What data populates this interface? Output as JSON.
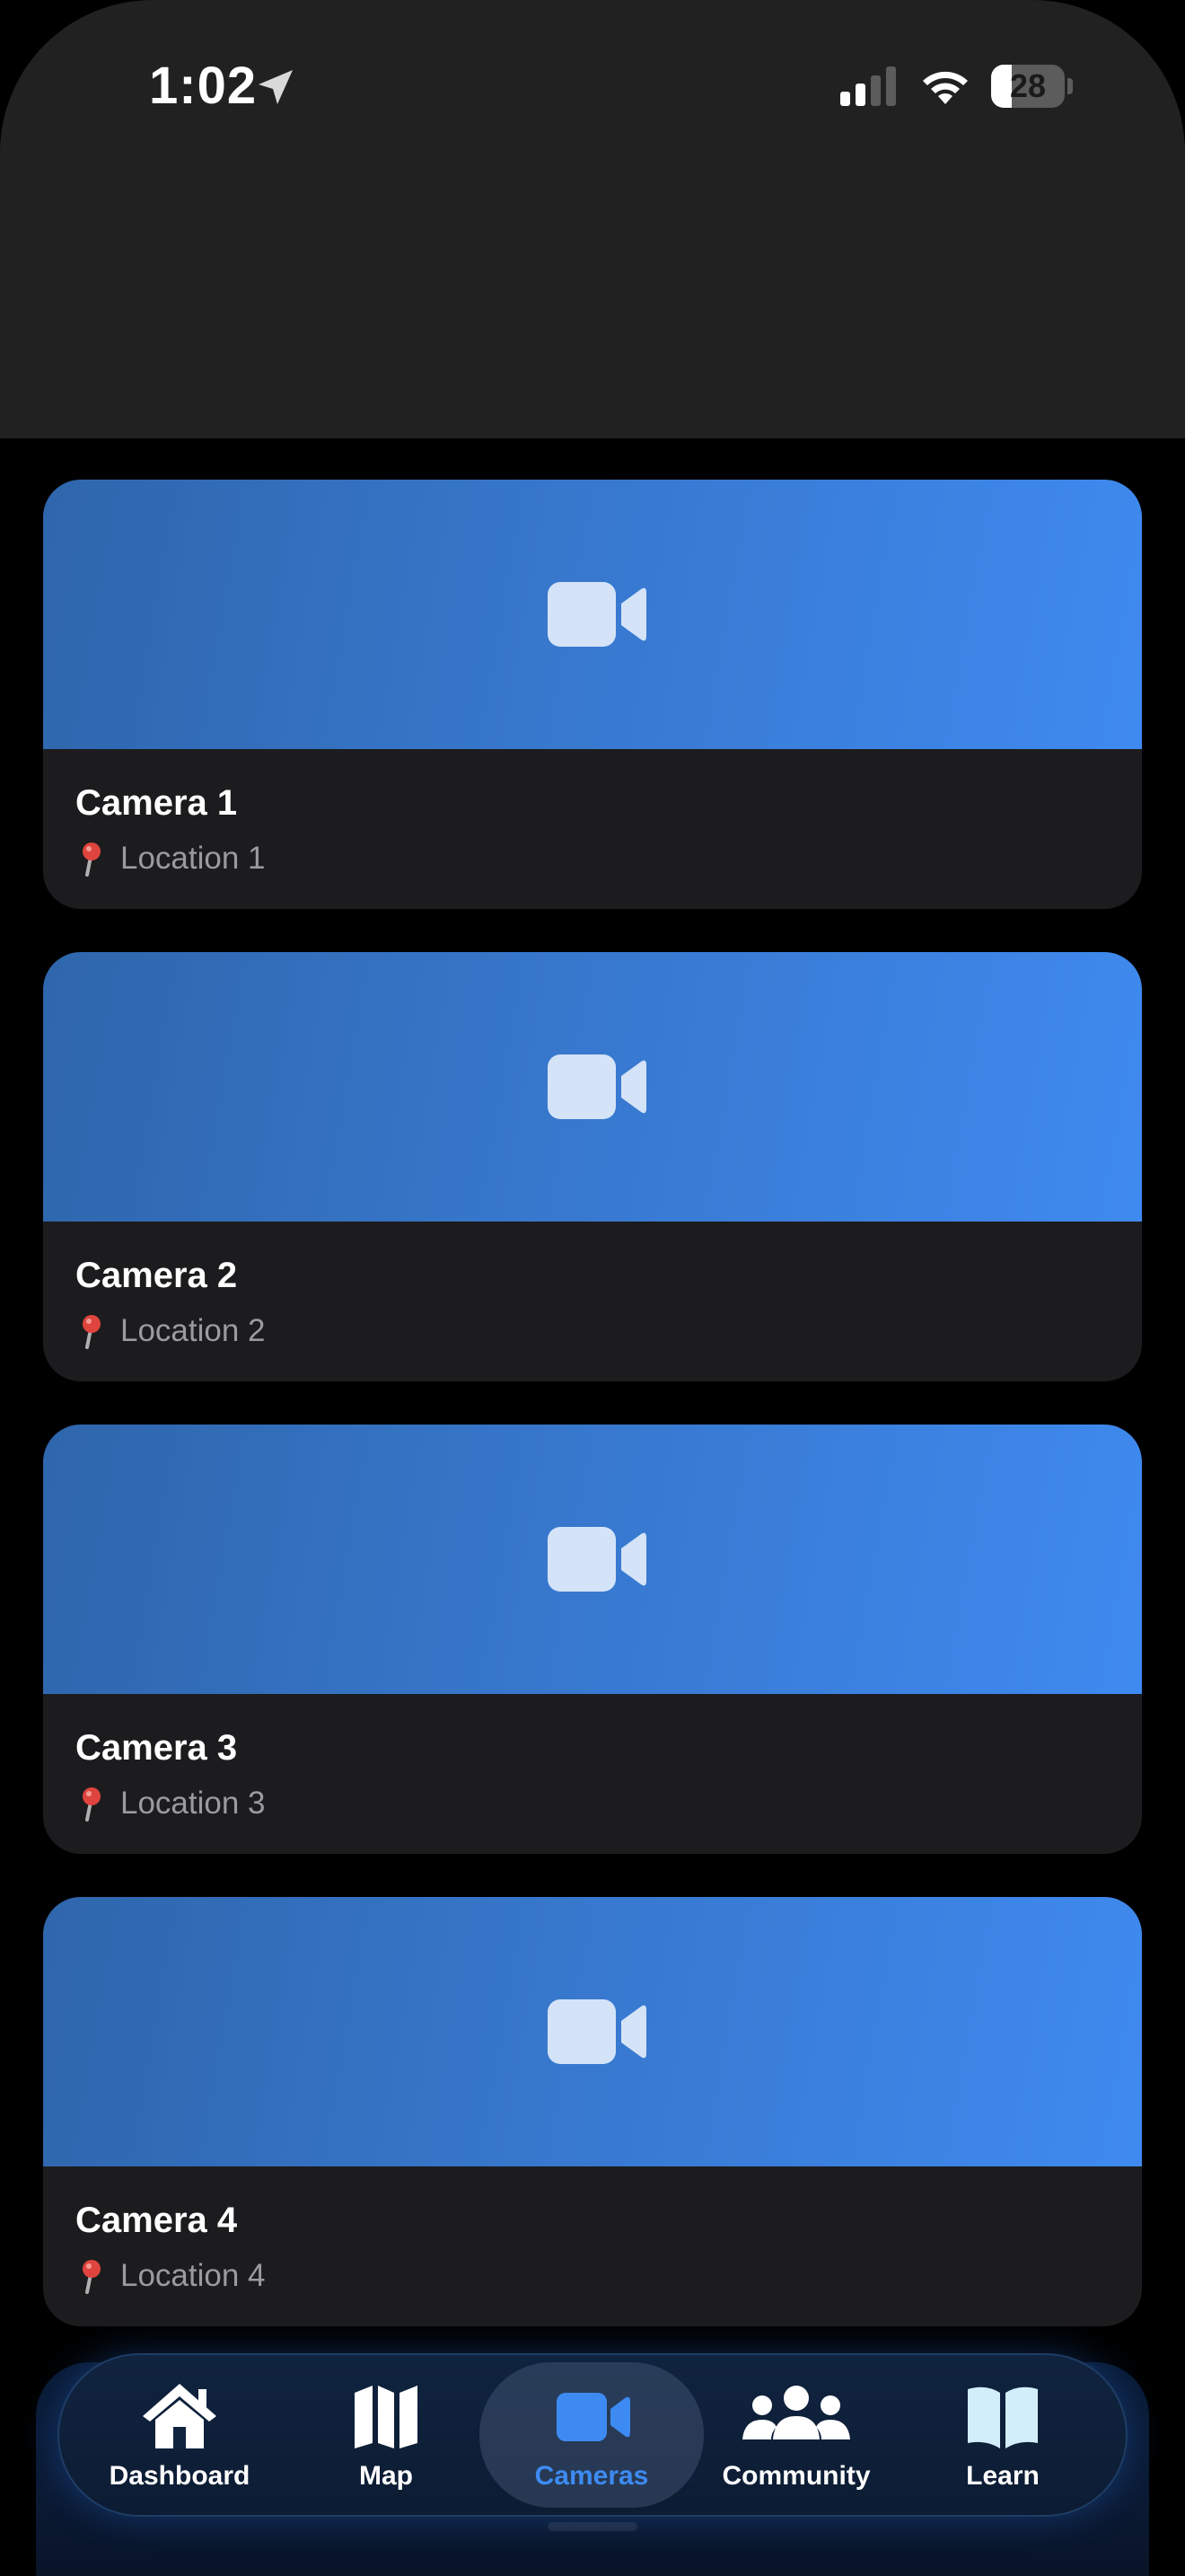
{
  "status_bar": {
    "time": "1:02",
    "battery": "28",
    "battery_level": 0.28
  },
  "cameras": [
    {
      "title": "Camera 1",
      "location": "Location 1"
    },
    {
      "title": "Camera 2",
      "location": "Location 2"
    },
    {
      "title": "Camera 3",
      "location": "Location 3"
    },
    {
      "title": "Camera 4",
      "location": "Location 4"
    }
  ],
  "tab_bar": {
    "items": [
      {
        "label": "Dashboard",
        "icon": "house-icon"
      },
      {
        "label": "Map",
        "icon": "map-icon"
      },
      {
        "label": "Cameras",
        "icon": "video-camera-icon",
        "selected": true
      },
      {
        "label": "Community",
        "icon": "people-icon"
      },
      {
        "label": "Learn",
        "icon": "book-icon"
      }
    ]
  },
  "colors": {
    "accent": "#3d8bf2",
    "background": "#000000",
    "header": "#212121",
    "card": "#1c1c1e",
    "location_pin": "#e0443e"
  }
}
